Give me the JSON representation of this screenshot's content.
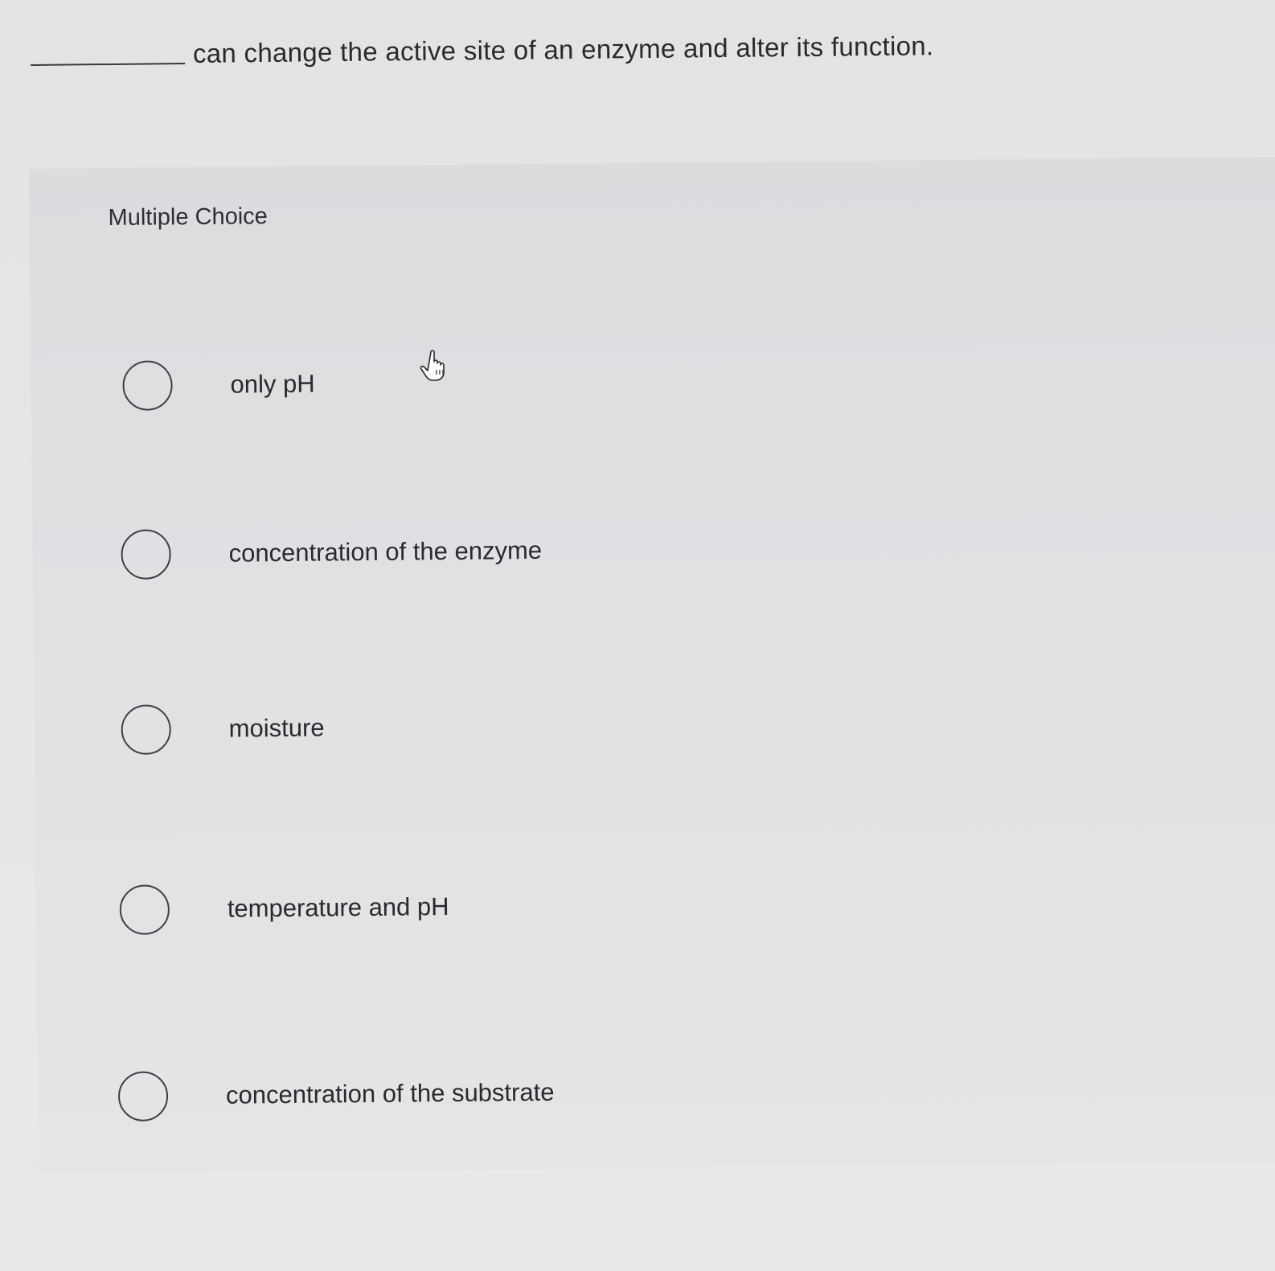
{
  "question": {
    "text": "can change the active site of an enzyme and alter its function."
  },
  "section": {
    "label": "Multiple Choice"
  },
  "options": [
    {
      "label": "only pH"
    },
    {
      "label": "concentration of the enzyme"
    },
    {
      "label": "moisture"
    },
    {
      "label": "temperature and pH"
    },
    {
      "label": "concentration of the substrate"
    }
  ],
  "colors": {
    "background": "#e6e6e8",
    "text": "#2b2b2e",
    "radio_border": "#3e3e44"
  },
  "icons": {
    "cursor": "hand-pointer-icon"
  }
}
